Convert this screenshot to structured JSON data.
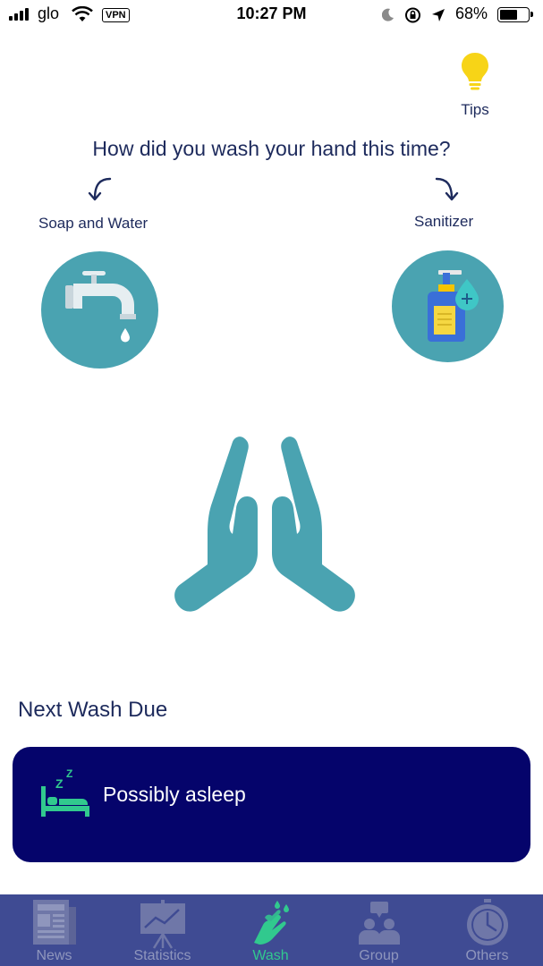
{
  "status_bar": {
    "carrier": "glo",
    "vpn": "VPN",
    "time": "10:27 PM",
    "battery_percent": "68%",
    "battery_level": 0.68
  },
  "tips": {
    "label": "Tips",
    "icon": "lightbulb-icon"
  },
  "question": "How did you wash your hand this time?",
  "options": {
    "soap": {
      "label": "Soap and Water",
      "icon": "faucet-icon"
    },
    "sanitizer": {
      "label": "Sanitizer",
      "icon": "sanitizer-bottle-icon"
    }
  },
  "center_icon": "praying-hands-icon",
  "next_wash": {
    "title": "Next Wash Due",
    "status": "Possibly asleep",
    "status_icon": "sleeping-bed-icon"
  },
  "tab_bar": {
    "tabs": [
      {
        "label": "News",
        "icon": "newspaper-icon"
      },
      {
        "label": "Statistics",
        "icon": "chart-board-icon"
      },
      {
        "label": "Wash",
        "icon": "washing-hands-icon",
        "active": true
      },
      {
        "label": "Group",
        "icon": "group-icon"
      },
      {
        "label": "Others",
        "icon": "clock-icon"
      }
    ]
  },
  "colors": {
    "teal": "#4aa3b1",
    "navy_text": "#1d2a5c",
    "card_bg": "#05046b",
    "tab_bar_bg": "#3f4b93",
    "active_tab": "#31c98e",
    "inactive_tab": "#8f96bd",
    "tips_bulb": "#f7d417"
  }
}
